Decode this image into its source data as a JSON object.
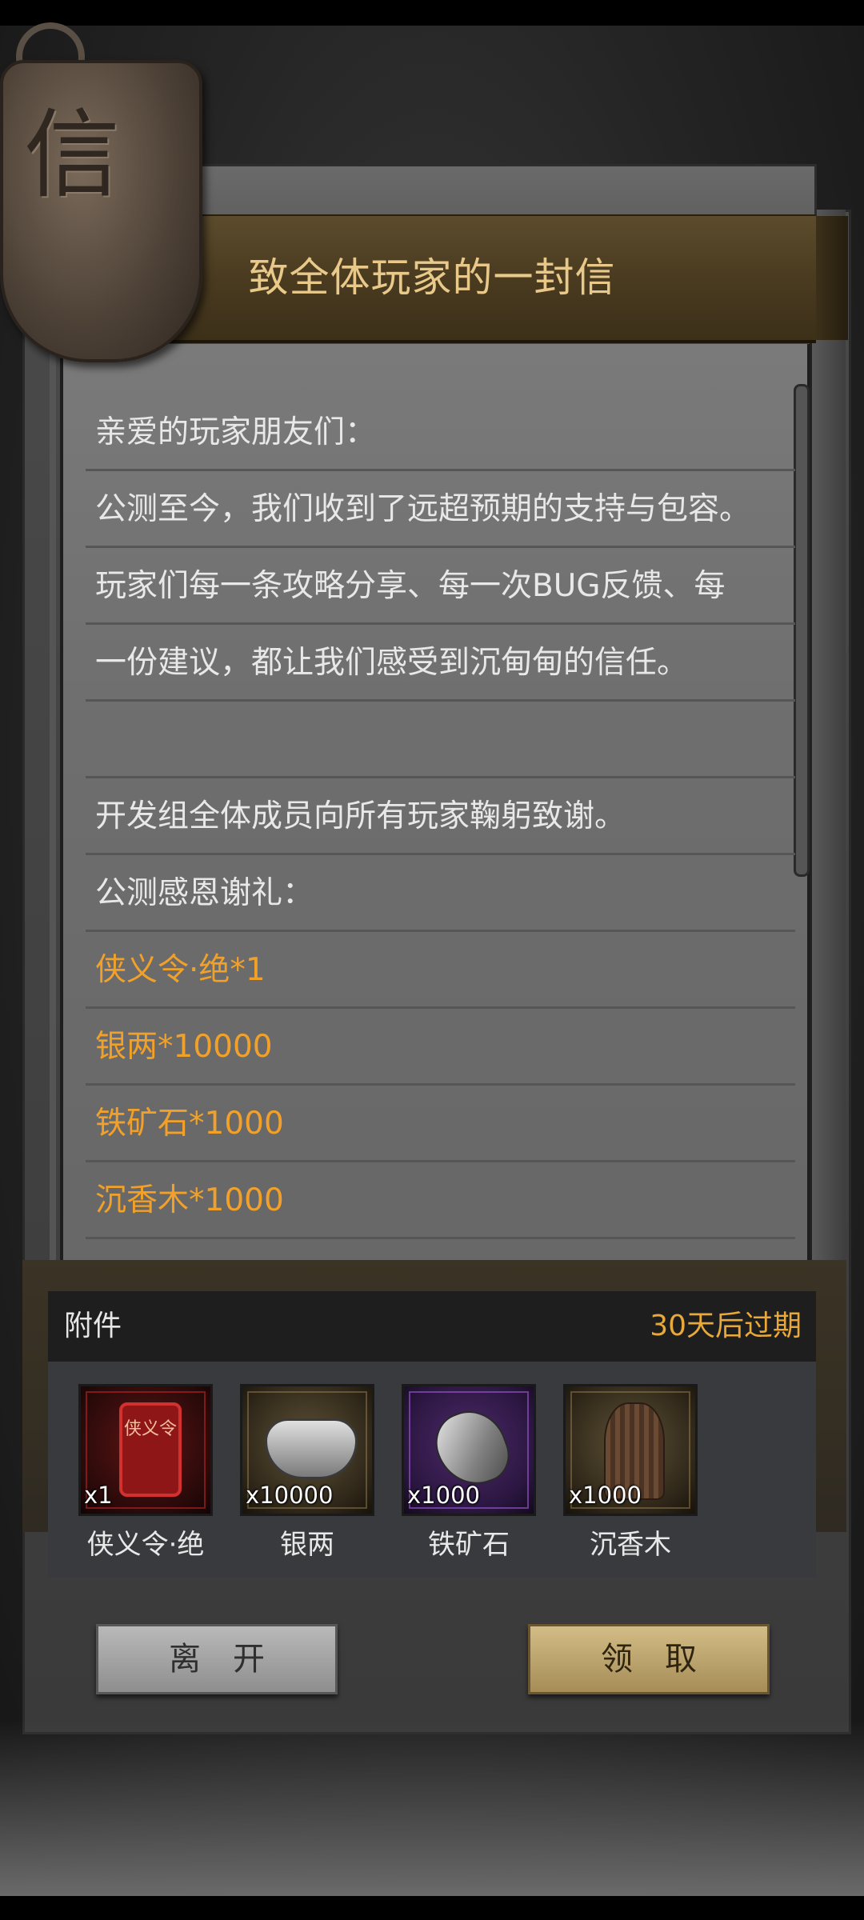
{
  "letter": {
    "title": "致全体玩家的一封信",
    "emblem_char": "信",
    "lines": [
      "亲爱的玩家朋友们：",
      "公测至今，我们收到了远超预期的支持与包容。",
      "玩家们每一条攻略分享、每一次BUG反馈、每",
      "一份建议，都让我们感受到沉甸甸的信任。",
      "",
      "开发组全体成员向所有玩家鞠躬致谢。",
      "公测感恩谢礼：",
      "侠义令·绝*1",
      "银两*10000",
      "铁矿石*1000",
      "沉香木*1000"
    ]
  },
  "attachments": {
    "title": "附件",
    "expire": "30天后过期",
    "items": [
      {
        "name": "侠义令·绝",
        "count": "x1",
        "icon": "xiayi-token-icon",
        "rarity_color": "#d33030",
        "icon_text": "侠义令"
      },
      {
        "name": "银两",
        "count": "x10000",
        "icon": "silver-ingot-icon",
        "rarity_color": "#c8aa6e"
      },
      {
        "name": "铁矿石",
        "count": "x1000",
        "icon": "iron-ore-icon",
        "rarity_color": "#a05ad2"
      },
      {
        "name": "沉香木",
        "count": "x1000",
        "icon": "agarwood-icon",
        "rarity_color": "#c8aa6e"
      }
    ]
  },
  "buttons": {
    "leave": "离开",
    "claim": "领取"
  },
  "colors": {
    "title_gold": "#e8c98a",
    "reward_orange": "#f1a12a",
    "expire_orange": "#e8a83a"
  }
}
